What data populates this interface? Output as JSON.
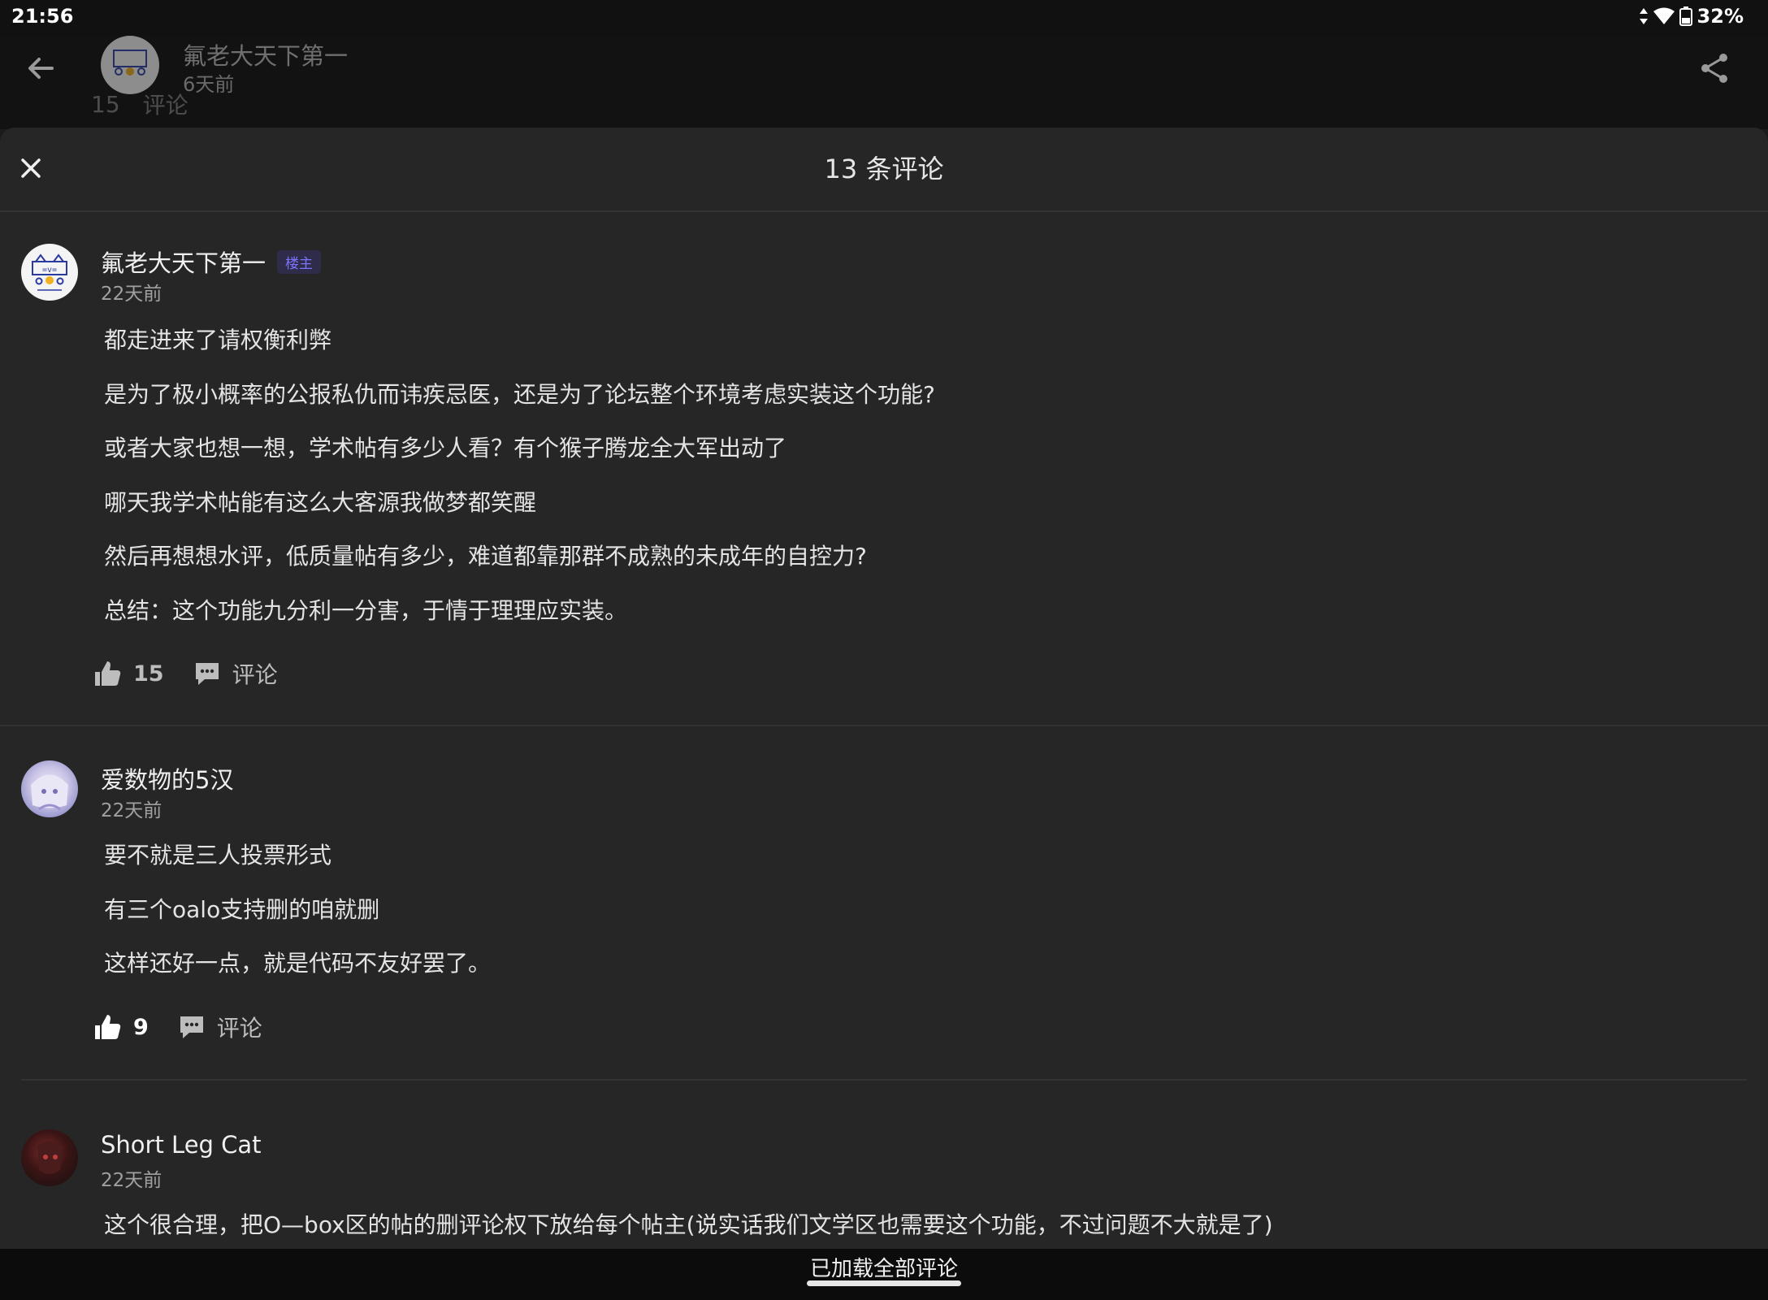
{
  "status": {
    "time": "21:56",
    "battery": "32%"
  },
  "post_header": {
    "author": "氟老大天下第一",
    "time": "6天前",
    "like_count": "15",
    "comment_label": "评论"
  },
  "sheet": {
    "title": "13 条评论",
    "comments": [
      {
        "author": "氟老大天下第一",
        "badge": "楼主",
        "time": "22天前",
        "lines": [
          "都走进来了请权衡利弊",
          "是为了极小概率的公报私仇而讳疾忌医，还是为了论坛整个环境考虑实装这个功能?",
          "或者大家也想一想，学术帖有多少人看？有个猴子腾龙全大军出动了",
          "哪天我学术帖能有这么大客源我做梦都笑醒",
          "然后再想想水评，低质量帖有多少，难道都靠那群不成熟的未成年的自控力?",
          "总结：这个功能九分利一分害，于情于理理应实装。"
        ],
        "likes": "15",
        "liked": false,
        "comment_label": "评论"
      },
      {
        "author": "爱数物的5汉",
        "time": "22天前",
        "lines": [
          "要不就是三人投票形式",
          "有三个oalo支持删的咱就删",
          "这样还好一点，就是代码不友好罢了。"
        ],
        "likes": "9",
        "liked": true,
        "comment_label": "评论"
      },
      {
        "author": "Short Leg Cat",
        "time": "22天前",
        "lines": [
          "这个很合理，把O—box区的帖的删评论权下放给每个帖主(说实话我们文学区也需要这个功能，不过问题不大就是了)"
        ]
      }
    ]
  },
  "footer": {
    "text": "已加载全部评论"
  },
  "colors": {
    "badge_text": "#7d73ff",
    "background": "#262626"
  },
  "icons": [
    "back-arrow-icon",
    "share-icon",
    "close-icon",
    "thumbs-up-icon",
    "comment-bubble-icon",
    "wifi-icon",
    "battery-icon"
  ]
}
